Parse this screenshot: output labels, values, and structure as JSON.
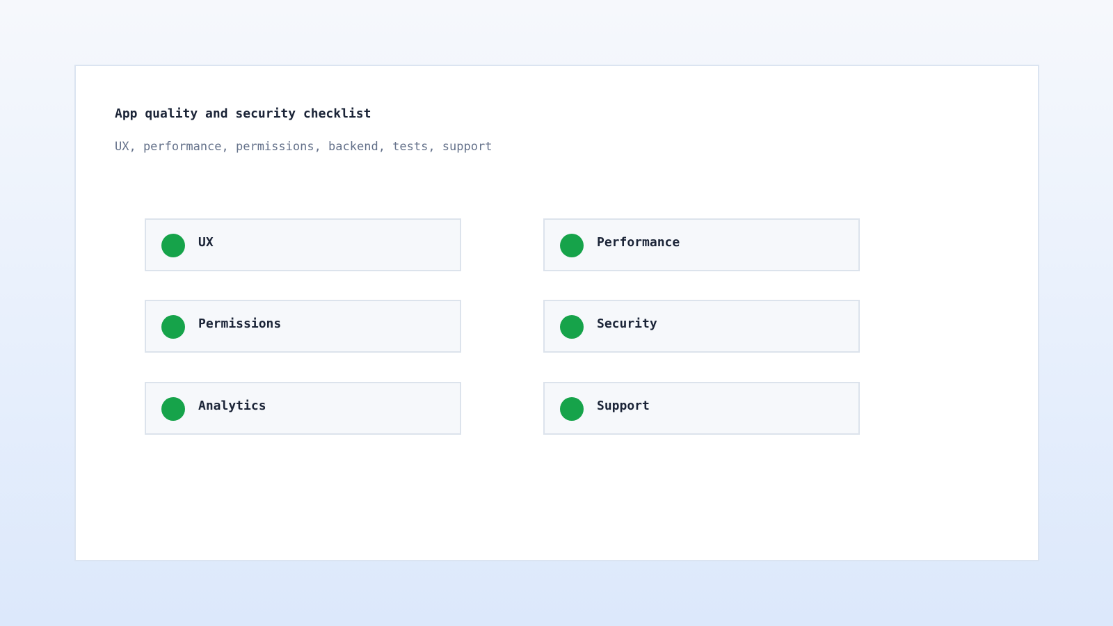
{
  "header": {
    "title": "App quality and security checklist",
    "subtitle": "UX, performance, permissions, backend, tests, support"
  },
  "checklist": {
    "status_color": "#16a34a",
    "items": [
      {
        "label": "UX",
        "status": "complete"
      },
      {
        "label": "Performance",
        "status": "complete"
      },
      {
        "label": "Permissions",
        "status": "complete"
      },
      {
        "label": "Security",
        "status": "complete"
      },
      {
        "label": "Analytics",
        "status": "complete"
      },
      {
        "label": "Support",
        "status": "complete"
      }
    ]
  }
}
